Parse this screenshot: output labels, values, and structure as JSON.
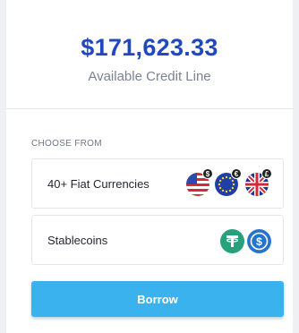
{
  "credit": {
    "amount": "$171,623.33",
    "caption": "Available Credit Line"
  },
  "choose": {
    "label": "CHOOSE FROM",
    "options": [
      {
        "label": "40+ Fiat Currencies",
        "icons": [
          "us-dollar-flag-icon",
          "euro-flag-icon",
          "british-pound-flag-icon"
        ],
        "badges": [
          "$",
          "€",
          "£"
        ]
      },
      {
        "label": "Stablecoins",
        "icons": [
          "tether-icon",
          "usd-coin-icon"
        ]
      }
    ]
  },
  "actions": {
    "borrow_label": "Borrow"
  },
  "colors": {
    "amount": "#2148c0",
    "borrow_button": "#3ab2ee",
    "tether": "#26a17b",
    "usd_coin": "#2775ca"
  }
}
